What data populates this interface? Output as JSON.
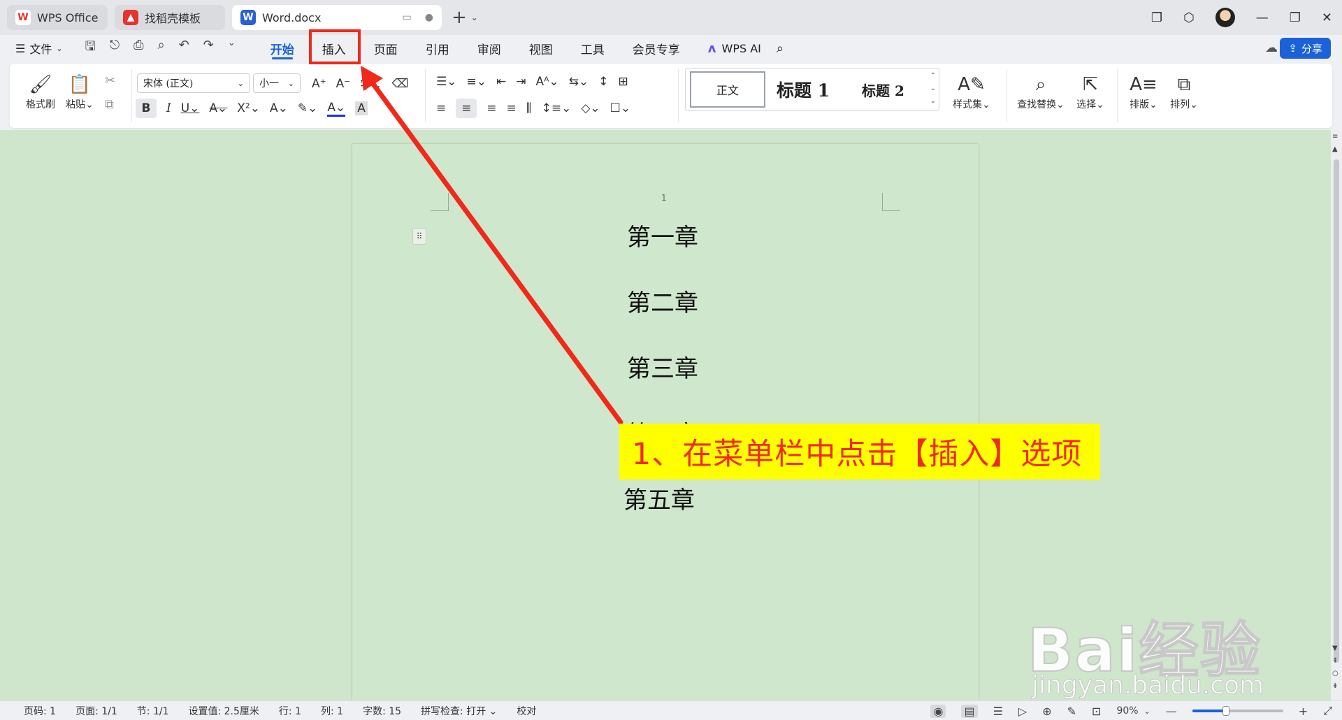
{
  "tabs": [
    {
      "label": "WPS Office",
      "logo": "W",
      "color": "#e8322d"
    },
    {
      "label": "找稻壳模板",
      "logo": "▲",
      "color": "#e8322d"
    },
    {
      "label": "Word.docx",
      "logo": "W",
      "color": "#2a5fd6"
    }
  ],
  "menubar": {
    "file_label": "文件",
    "tabs": [
      "开始",
      "插入",
      "页面",
      "引用",
      "审阅",
      "视图",
      "工具",
      "会员专享"
    ],
    "active_tab": "开始",
    "ai_label": "WPS AI",
    "share_label": "分享"
  },
  "ribbon": {
    "format_painter": "格式刷",
    "paste": "粘贴",
    "font_name": "宋体 (正文)",
    "font_size": "小一",
    "styles": {
      "normal": "正文",
      "h1": "标题 1",
      "h2": "标题 2"
    },
    "style_set": "样式集",
    "find_replace": "查找替换",
    "select": "选择",
    "typeset": "排版",
    "arrange": "排列"
  },
  "document": {
    "page_number": "1",
    "chapters": [
      "第一章",
      "第二章",
      "第三章",
      "第四章",
      "第五章"
    ]
  },
  "annotation": {
    "callout_text": "1、在菜单栏中点击【插入】选项",
    "color": "#f0291a"
  },
  "watermark": {
    "main": "Bai经验",
    "url": "jingyan.baidu.com"
  },
  "statusbar": {
    "items": [
      "页码: 1",
      "页面: 1/1",
      "节: 1/1",
      "设置值: 2.5厘米",
      "行: 1",
      "列: 1",
      "字数: 15",
      "拼写检查: 打开",
      "校对"
    ],
    "zoom": "90%",
    "zoom_fraction": 0.37
  }
}
